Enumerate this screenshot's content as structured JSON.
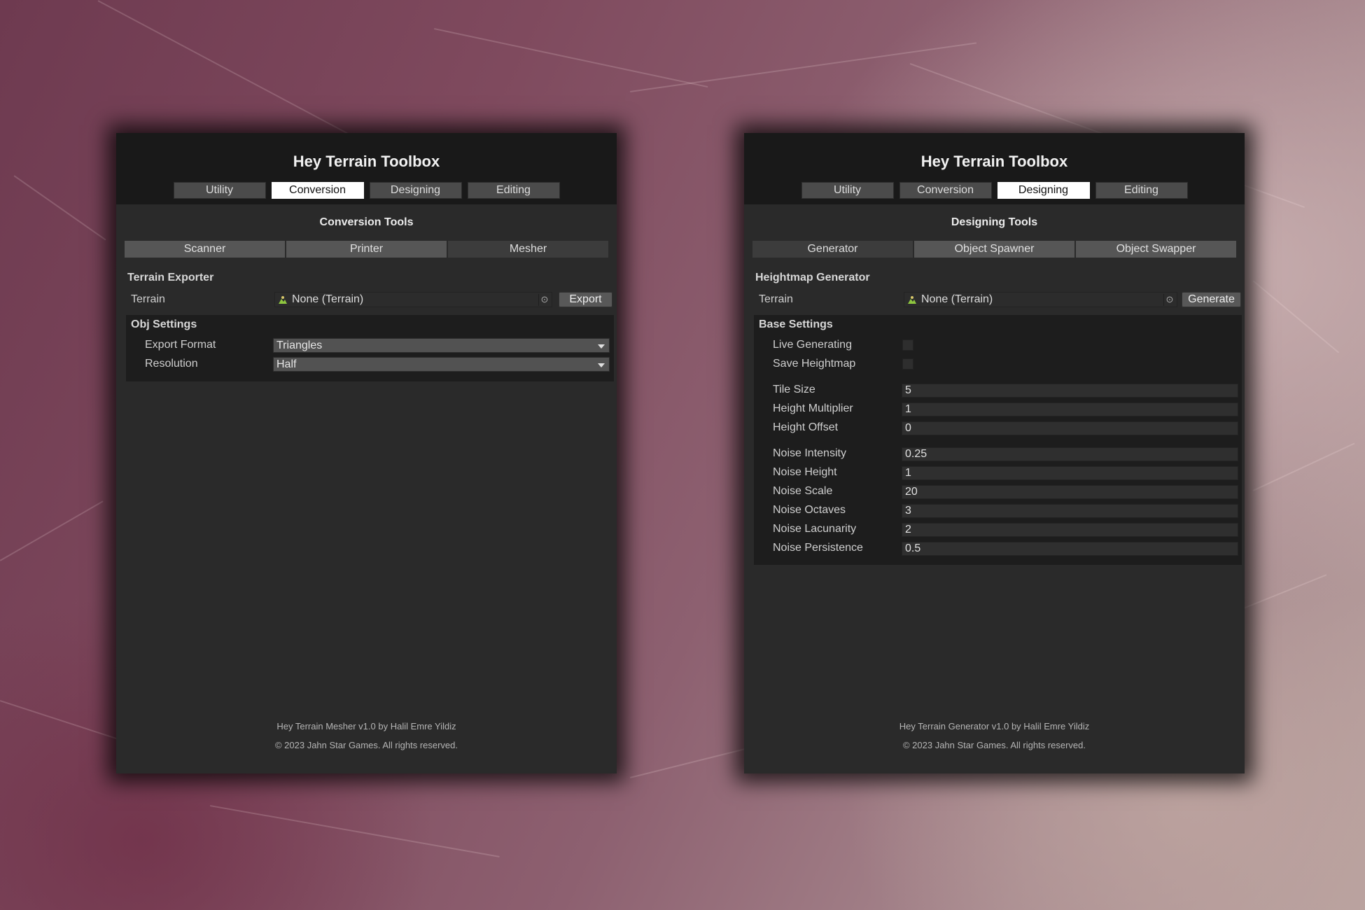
{
  "left_window": {
    "title": "Hey Terrain Toolbox",
    "tabs": [
      "Utility",
      "Conversion",
      "Designing",
      "Editing"
    ],
    "active_tab": "Conversion",
    "section_title": "Conversion Tools",
    "sub_tabs": [
      "Scanner",
      "Printer",
      "Mesher"
    ],
    "active_sub_tab": "Mesher",
    "group_title": "Terrain Exporter",
    "terrain_label": "Terrain",
    "terrain_value": "None (Terrain)",
    "action_button": "Export",
    "settings": {
      "title": "Obj Settings",
      "export_format_label": "Export Format",
      "export_format_value": "Triangles",
      "resolution_label": "Resolution",
      "resolution_value": "Half"
    },
    "footer_line1": "Hey Terrain Mesher v1.0 by Halil Emre Yildiz",
    "footer_line2": "© 2023 Jahn Star Games. All rights reserved."
  },
  "right_window": {
    "title": "Hey Terrain Toolbox",
    "tabs": [
      "Utility",
      "Conversion",
      "Designing",
      "Editing"
    ],
    "active_tab": "Designing",
    "section_title": "Designing Tools",
    "sub_tabs": [
      "Generator",
      "Object Spawner",
      "Object Swapper"
    ],
    "active_sub_tab": "Generator",
    "group_title": "Heightmap Generator",
    "terrain_label": "Terrain",
    "terrain_value": "None (Terrain)",
    "action_button": "Generate",
    "settings": {
      "title": "Base Settings",
      "live_generating_label": "Live Generating",
      "live_generating_checked": false,
      "save_heightmap_label": "Save Heightmap",
      "save_heightmap_checked": false,
      "fields": [
        {
          "label": "Tile Size",
          "value": "5"
        },
        {
          "label": "Height Multiplier",
          "value": "1"
        },
        {
          "label": "Height Offset",
          "value": "0"
        },
        {
          "label": "Noise Intensity",
          "value": "0.25"
        },
        {
          "label": "Noise Height",
          "value": "1"
        },
        {
          "label": "Noise Scale",
          "value": "20"
        },
        {
          "label": "Noise Octaves",
          "value": "3"
        },
        {
          "label": "Noise Lacunarity",
          "value": "2"
        },
        {
          "label": "Noise Persistence",
          "value": "0.5"
        }
      ]
    },
    "footer_line1": "Hey Terrain Generator v1.0 by Halil Emre Yildiz",
    "footer_line2": "© 2023 Jahn Star Games. All rights reserved."
  },
  "icons": {
    "terrain_field_icon": "terrain-icon",
    "object_picker_icon": "target-icon",
    "dropdown_icon": "chevron-down-icon"
  },
  "colors": {
    "window_bg": "#2a2a2a",
    "header_bg": "#191919",
    "active_tab": "#ffffff",
    "terrain_icon_green": "#8ec63f"
  }
}
